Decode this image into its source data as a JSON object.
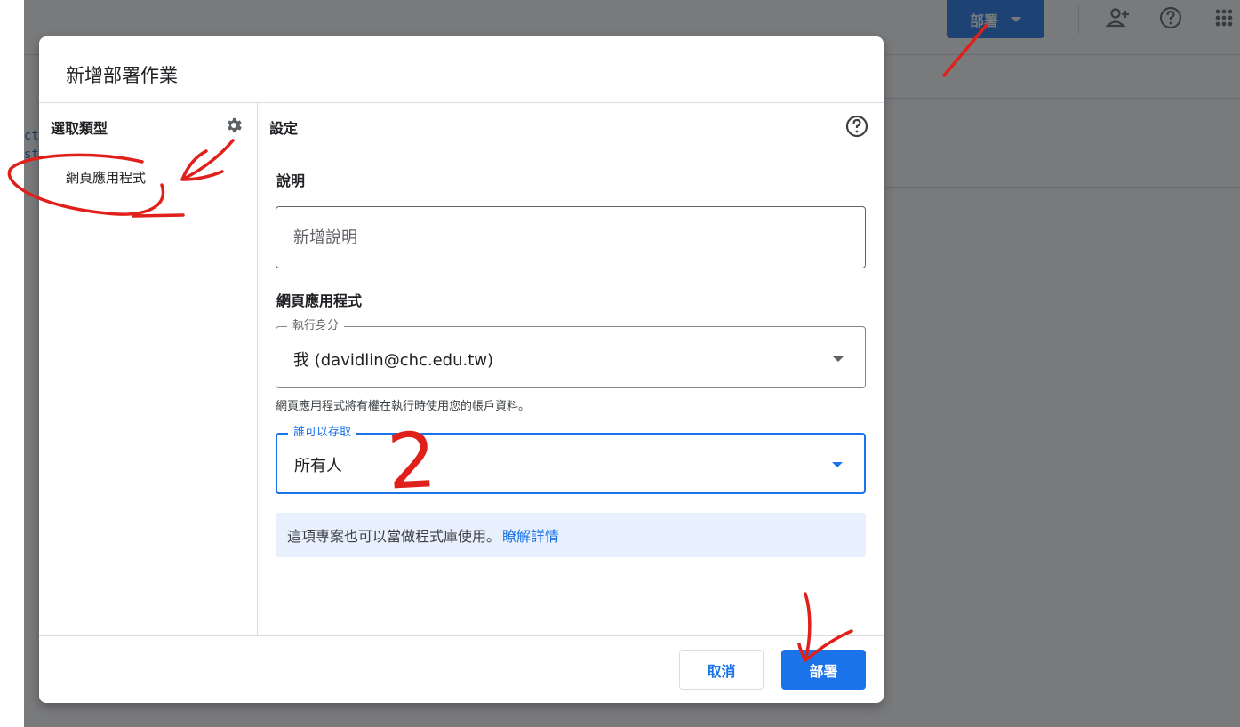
{
  "background": {
    "deploy_label": "部署",
    "code_lines": [
      "ct",
      "st"
    ]
  },
  "dialog": {
    "title": "新增部署作業",
    "left_header": "選取類型",
    "right_header": "設定",
    "type_items": [
      "網頁應用程式"
    ],
    "description": {
      "label": "說明",
      "placeholder": "新增說明"
    },
    "webapp": {
      "label": "網頁應用程式",
      "execute_as": {
        "legend": "執行身分",
        "value": "我 (davidlin@chc.edu.tw)"
      },
      "helper": "網頁應用程式將有權在執行時使用您的帳戶資料。",
      "access": {
        "legend": "誰可以存取",
        "value": "所有人"
      }
    },
    "info": {
      "text": "這項專案也可以當做程式庫使用。",
      "link": "瞭解詳情"
    },
    "cancel_label": "取消",
    "deploy_label": "部署"
  },
  "annotation_marks": {
    "number_label": "2"
  },
  "colors": {
    "primary": "#1a73e8",
    "info_bg": "#e8f0fe",
    "annotation": "#e0201b"
  }
}
